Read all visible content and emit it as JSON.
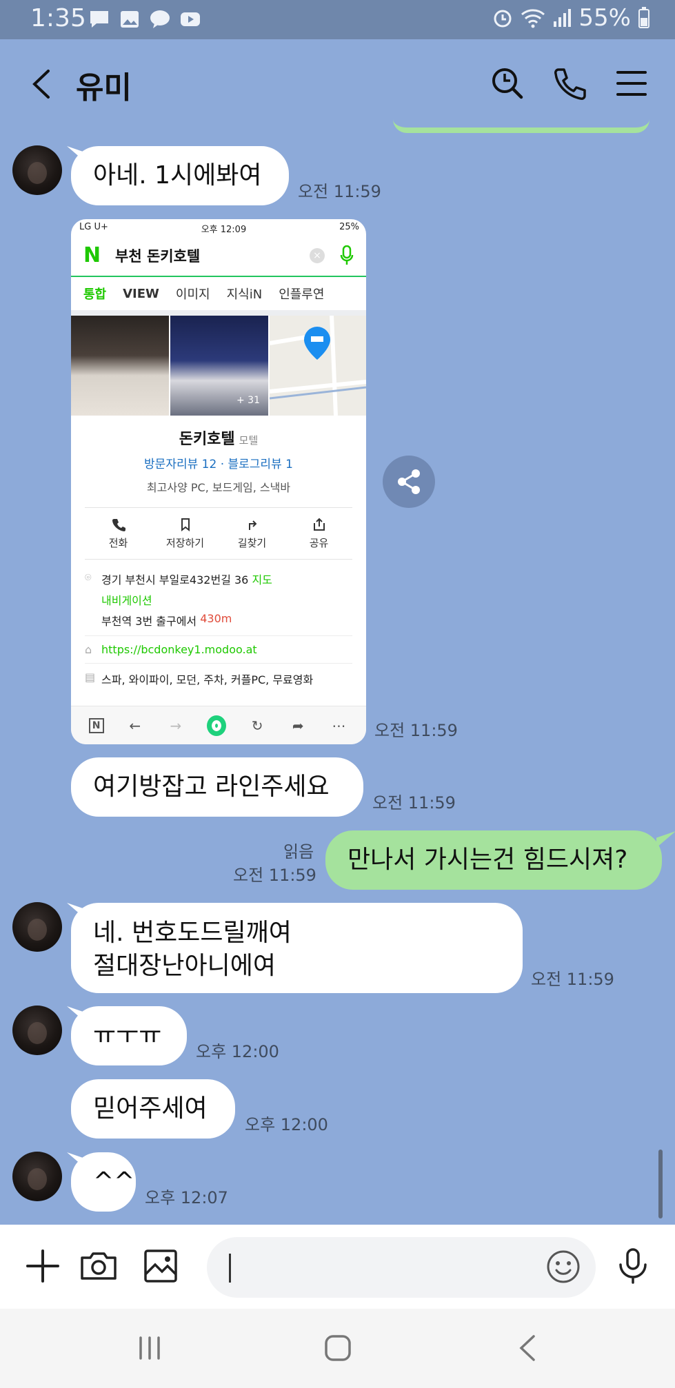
{
  "status": {
    "time": "1:35",
    "battery": "55%",
    "left_icons": [
      "message-icon",
      "gallery-icon",
      "talk-icon",
      "youtube-icon"
    ],
    "right_icons": [
      "alarm-icon",
      "wifi-icon",
      "signal-icon",
      "battery-icon"
    ]
  },
  "header": {
    "title": "유미",
    "buttons": [
      "back-icon",
      "search-icon",
      "call-icon",
      "menu-icon"
    ]
  },
  "messages": [
    {
      "id": "m1",
      "side": "in",
      "text": "아네. 1시에봐여",
      "time": "오전 11:59",
      "avatar": true
    },
    {
      "id": "m2",
      "side": "in",
      "type": "image",
      "time": "오전 11:59",
      "avatar": false
    },
    {
      "id": "m3",
      "side": "in",
      "text": "여기방잡고 라인주세요",
      "time": "오전 11:59",
      "avatar": false
    },
    {
      "id": "m4",
      "side": "out",
      "text": "만나서 가시는건 힘드시져?",
      "time": "오전 11:59",
      "read": "읽음"
    },
    {
      "id": "m5",
      "side": "in",
      "text": "네. 번호도드릴깨여\n절대장난아니에여",
      "time": "오전 11:59",
      "avatar": true
    },
    {
      "id": "m6",
      "side": "in",
      "text": "ㅠㅜㅠ",
      "time": "오후 12:00",
      "avatar": true
    },
    {
      "id": "m7",
      "side": "in",
      "text": "믿어주세여",
      "time": "오후 12:00",
      "avatar": false
    },
    {
      "id": "m8",
      "side": "in",
      "text": "^^",
      "time": "오후 12:07",
      "avatar": true
    }
  ],
  "shared_screenshot": {
    "status_left": "LG U+",
    "status_time": "오후 12:09",
    "status_battery": "25%",
    "search_query": "부천 돈키호텔",
    "tabs": [
      "통합",
      "VIEW",
      "이미지",
      "지식iN",
      "인플루연"
    ],
    "photo_count": "+ 31",
    "place_name": "돈키호텔",
    "place_category": "모텔",
    "visitor_reviews": "방문자리뷰 12",
    "blog_reviews": "블로그리뷰 1",
    "description": "최고사양 PC, 보드게임, 스낵바",
    "actions": [
      "전화",
      "저장하기",
      "길찾기",
      "공유"
    ],
    "address": "경기 부천시 부일로432번길 36",
    "map_link": "지도",
    "navigation_link": "내비게이션",
    "station": "부천역",
    "exit_text": "3번 출구에서",
    "distance": "430m",
    "website": "https://bcdonkey1.modoo.at",
    "amenities": "스파, 와이파이, 모던, 주차, 커플PC, 무료영화"
  },
  "input": {
    "placeholder": "",
    "buttons": [
      "plus-icon",
      "camera-icon",
      "image-icon",
      "emoji-icon",
      "mic-icon"
    ]
  },
  "colors": {
    "background": "#8daad9",
    "incoming_bubble": "#ffffff",
    "outgoing_bubble": "#a5e29d",
    "status_bar": "#6f87ab",
    "naver_green": "#1ec800"
  }
}
